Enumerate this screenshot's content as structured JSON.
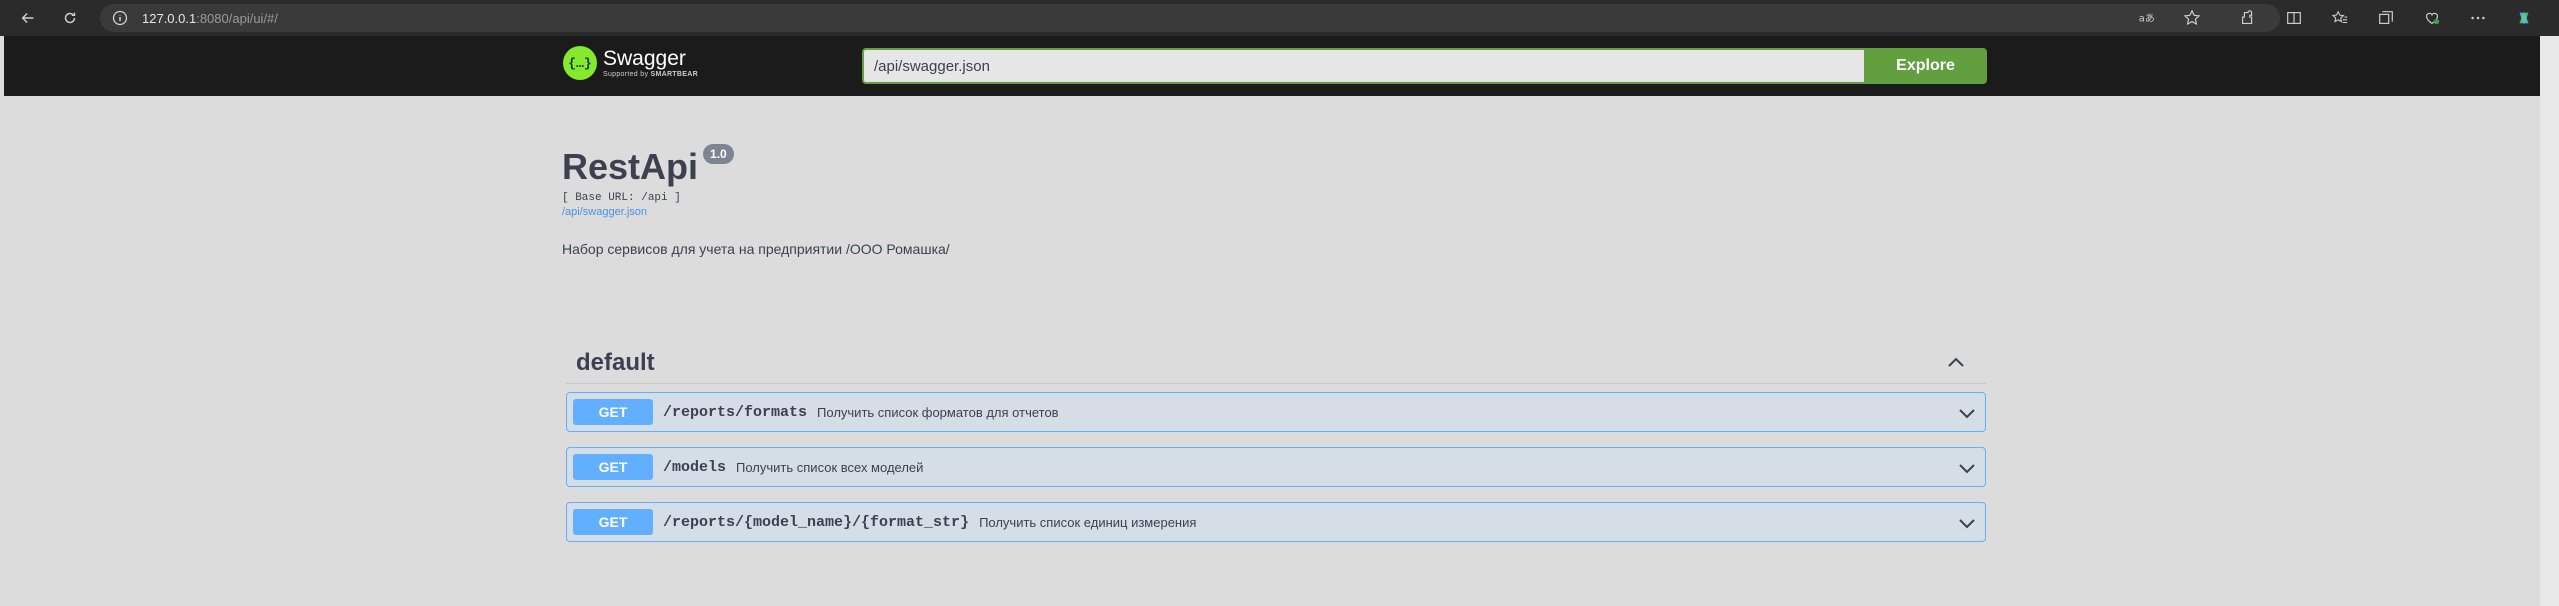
{
  "browser": {
    "url_host": "127.0.0.1",
    "url_rest": ":8080/api/ui/#/"
  },
  "swagger": {
    "logo_name": "Swagger",
    "logo_sub_prefix": "Supported by ",
    "logo_sub_brand": "SMARTBEAR",
    "logo_symbol": "{…}",
    "spec_url_value": "/api/swagger.json",
    "explore_label": "Explore"
  },
  "info": {
    "title": "RestApi",
    "version": "1.0",
    "base_url": "[ Base URL: /api ]",
    "spec_link": "/api/swagger.json",
    "description": "Набор сервисов для учета на предприятии /ООО Ромашка/"
  },
  "tag": {
    "name": "default"
  },
  "operations": [
    {
      "method": "GET",
      "path": "/reports/formats",
      "summary": "Получить список форматов для отчетов"
    },
    {
      "method": "GET",
      "path": "/models",
      "summary": "Получить список всех моделей"
    },
    {
      "method": "GET",
      "path": "/reports/{model_name}/{format_str}",
      "summary": "Получить список единиц измерения"
    }
  ],
  "colors": {
    "get_accent": "#61affe",
    "swagger_green": "#62a03f",
    "topbar": "#1b1b1b"
  }
}
